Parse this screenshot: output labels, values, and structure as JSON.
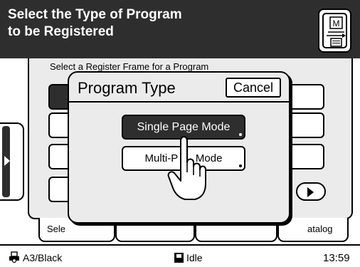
{
  "header": {
    "title_line1": "Select the Type of Program",
    "title_line2": "to be Registered",
    "menu_icon_letter": "M"
  },
  "background": {
    "instruction": "Select a Register Frame for a Program",
    "tabs": [
      {
        "label": "Sele"
      },
      {
        "label": ""
      },
      {
        "label": ""
      },
      {
        "label": "atalog"
      }
    ]
  },
  "dialog": {
    "title": "Program Type",
    "cancel_label": "Cancel",
    "single_page_label": "Single Page Mode",
    "multi_page_label": "Multi-P      Mode"
  },
  "status": {
    "paper": "A3/Black",
    "state": "Idle",
    "time": "13:59"
  },
  "colors": {
    "header_bg": "#2e2e2e",
    "panel_bg": "#ebebeb",
    "selected_bg": "#2e2e2e"
  },
  "icons": {
    "menu": "memory-menu-icon",
    "side_tab": "side-panel-arrow-icon",
    "scroll": "scroll-right-icon",
    "paper": "paper-tray-icon",
    "state": "printer-status-icon",
    "pointer": "pointing-hand-icon"
  }
}
